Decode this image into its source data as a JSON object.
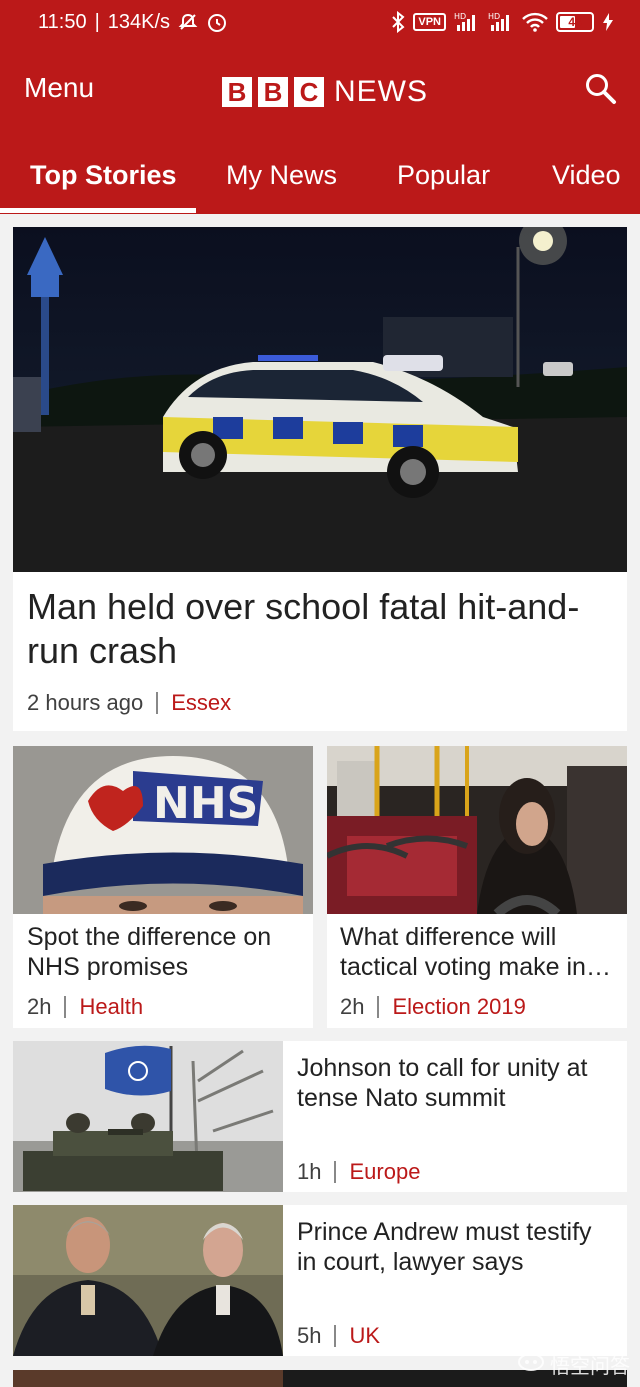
{
  "status_bar": {
    "time": "11:50",
    "speed": "134K/s",
    "vpn": "VPN",
    "hd1": "HD",
    "hd2": "HD",
    "battery": "43"
  },
  "header": {
    "menu_label": "Menu",
    "logo_letters": [
      "B",
      "B",
      "C"
    ],
    "logo_word": "NEWS",
    "brand_color": "#bb1919"
  },
  "tabs": [
    {
      "label": "Top Stories",
      "active": true
    },
    {
      "label": "My News",
      "active": false
    },
    {
      "label": "Popular",
      "active": false
    },
    {
      "label": "Video",
      "active": false
    }
  ],
  "stories": {
    "lead": {
      "headline": "Man held over school fatal hit-and-run crash",
      "time": "2 hours ago",
      "category": "Essex"
    },
    "grid": [
      {
        "headline": "Spot the difference on NHS promises",
        "time": "2h",
        "category": "Health"
      },
      {
        "headline": "What difference will tactical voting make in…",
        "time": "2h",
        "category": "Election 2019"
      }
    ],
    "list": [
      {
        "headline": "Johnson to call for unity at tense Nato summit",
        "time": "1h",
        "category": "Europe"
      },
      {
        "headline": "Prince Andrew must testify in court, lawyer says",
        "time": "5h",
        "category": "UK"
      }
    ]
  },
  "watermark": "悟空问答"
}
